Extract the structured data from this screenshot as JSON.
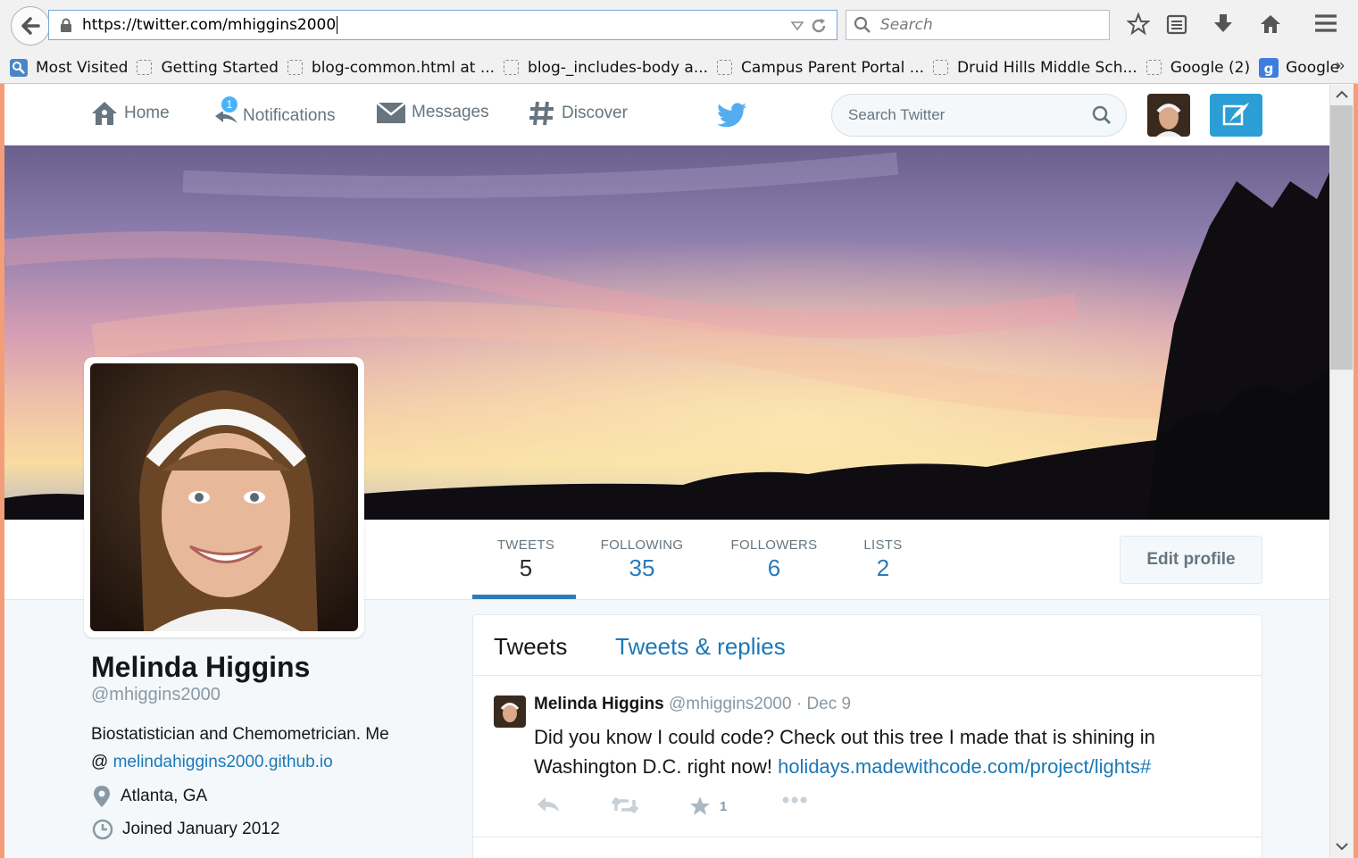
{
  "browser": {
    "url": "https://twitter.com/mhiggins2000",
    "search_placeholder": "Search",
    "bookmarks": [
      {
        "label": "Most Visited"
      },
      {
        "label": "Getting Started"
      },
      {
        "label": "blog-common.html at ..."
      },
      {
        "label": "blog-_includes-body a..."
      },
      {
        "label": "Campus Parent Portal ..."
      },
      {
        "label": "Druid Hills Middle Sch..."
      },
      {
        "label": "Google (2)"
      },
      {
        "label": "Google"
      }
    ],
    "overflow_label": "»"
  },
  "nav": {
    "home": "Home",
    "notifications": "Notifications",
    "notifications_count": "1",
    "messages": "Messages",
    "discover": "Discover",
    "search_placeholder": "Search Twitter"
  },
  "profile": {
    "stats": [
      {
        "label": "TWEETS",
        "value": "5"
      },
      {
        "label": "FOLLOWING",
        "value": "35"
      },
      {
        "label": "FOLLOWERS",
        "value": "6"
      },
      {
        "label": "LISTS",
        "value": "2"
      }
    ],
    "edit_profile_label": "Edit profile",
    "name": "Melinda Higgins",
    "handle": "@mhiggins2000",
    "bio_text": "Biostatistician and Chemometrician. Me",
    "bio_prefix": "@ ",
    "bio_link": "melindahiggins2000.github.io",
    "location": "Atlanta, GA",
    "joined": "Joined January 2012"
  },
  "timeline": {
    "tabs": [
      {
        "label": "Tweets"
      },
      {
        "label": "Tweets & replies"
      }
    ],
    "tweets": [
      {
        "name": "Melinda Higgins",
        "handle": "@mhiggins2000",
        "dot": "·",
        "time": "Dec 9",
        "text": "Did you know I could code? Check out this tree I made that is shining in Washington D.C. right now! ",
        "link": "holidays.madewithcode.com/project/lights#",
        "favorite_count": "1"
      }
    ]
  },
  "colors": {
    "accent": "#2b7bb9",
    "link": "#1b78b8",
    "twitter_blue": "#55acee",
    "compose_button": "#2b9ed5",
    "window_edge": "#f39e78"
  }
}
